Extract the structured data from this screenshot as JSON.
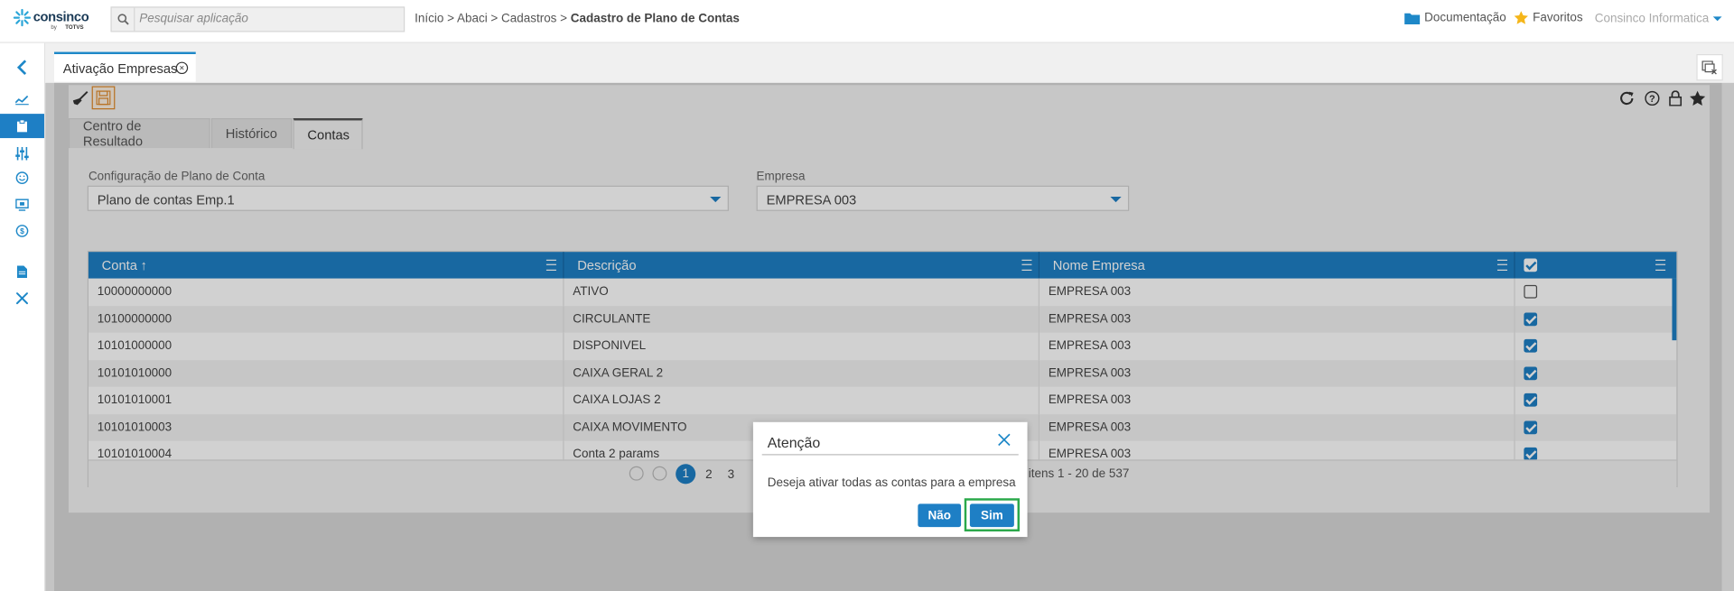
{
  "header": {
    "brand": "consinco",
    "brand_by": "by",
    "brand_sub": "TOTVS",
    "search_placeholder": "Pesquisar aplicação",
    "breadcrumb_path": "Início > Abaci > Cadastros > ",
    "breadcrumb_current": "Cadastro de Plano de Contas",
    "docs_label": "Documentação",
    "favs_label": "Favoritos",
    "user_label": "Consinco Informatica"
  },
  "page_tab": {
    "label": "Ativação Empresas",
    "close": "×"
  },
  "tabs": [
    {
      "label": "Centro de Resultado"
    },
    {
      "label": "Histórico"
    },
    {
      "label": "Contas",
      "active": true
    }
  ],
  "fields": {
    "config_label": "Configuração de Plano de Conta",
    "config_value": "Plano de contas Emp.1",
    "empresa_label": "Empresa",
    "empresa_value": "EMPRESA 003"
  },
  "grid": {
    "columns": [
      "Conta",
      "Descrição",
      "Nome Empresa"
    ],
    "sort_arrow": "↑",
    "rows": [
      {
        "conta": "10000000000",
        "descricao": "ATIVO",
        "empresa": "EMPRESA 003",
        "checked": false
      },
      {
        "conta": "10100000000",
        "descricao": "CIRCULANTE",
        "empresa": "EMPRESA 003",
        "checked": true
      },
      {
        "conta": "10101000000",
        "descricao": "DISPONIVEL",
        "empresa": "EMPRESA 003",
        "checked": true
      },
      {
        "conta": "10101010000",
        "descricao": "CAIXA GERAL 2",
        "empresa": "EMPRESA 003",
        "checked": true
      },
      {
        "conta": "10101010001",
        "descricao": "CAIXA LOJAS 2",
        "empresa": "EMPRESA 003",
        "checked": true
      },
      {
        "conta": "10101010003",
        "descricao": "CAIXA MOVIMENTO",
        "empresa": "EMPRESA 003",
        "checked": true
      },
      {
        "conta": "10101010004",
        "descricao": "Conta 2 params",
        "empresa": "EMPRESA 003",
        "checked": true
      }
    ],
    "pager": {
      "pages": [
        "1",
        "2",
        "3"
      ],
      "current": "1",
      "summary": "itens 1 - 20 de 537"
    }
  },
  "dialog": {
    "title": "Atenção",
    "message": "Deseja ativar todas as contas para a empresa",
    "no_label": "Não",
    "yes_label": "Sim"
  },
  "colors": {
    "accent": "#1e7fc5",
    "highlight_border": "#2aa84a",
    "save_icon": "#e08a2b"
  }
}
